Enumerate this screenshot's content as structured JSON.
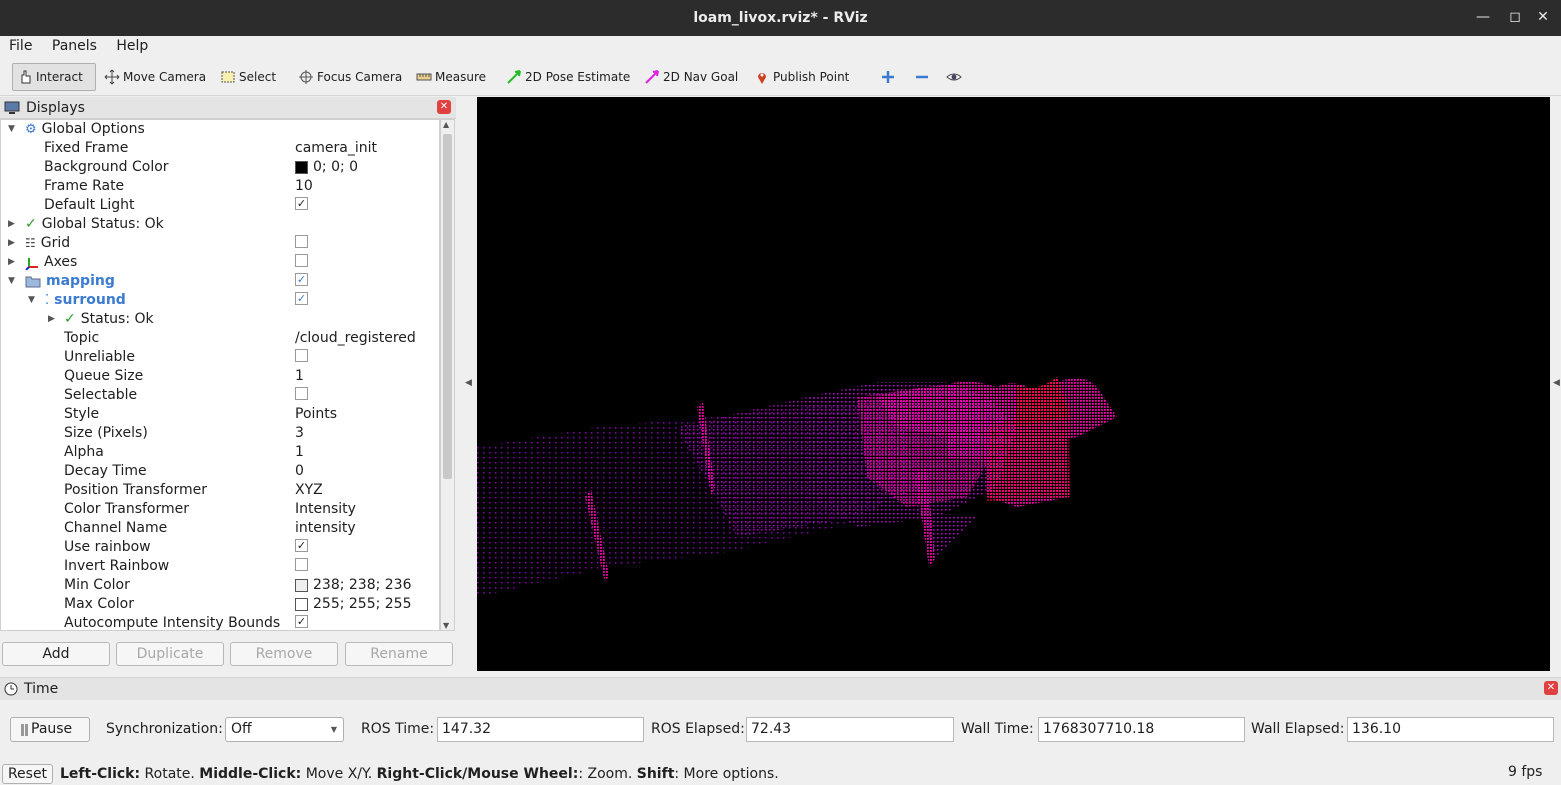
{
  "window": {
    "title": "loam_livox.rviz* - RViz"
  },
  "menu": {
    "file": "File",
    "panels": "Panels",
    "help": "Help"
  },
  "toolbar": {
    "interact": "Interact",
    "move_camera": "Move Camera",
    "select": "Select",
    "focus_camera": "Focus Camera",
    "measure": "Measure",
    "pose_estimate": "2D Pose Estimate",
    "nav_goal": "2D Nav Goal",
    "publish_point": "Publish Point"
  },
  "displays": {
    "title": "Displays",
    "global_options": "Global Options",
    "fixed_frame": {
      "label": "Fixed Frame",
      "value": "camera_init"
    },
    "background_color": {
      "label": "Background Color",
      "value": "0; 0; 0",
      "swatch": "#000000"
    },
    "frame_rate": {
      "label": "Frame Rate",
      "value": "10"
    },
    "default_light": {
      "label": "Default Light",
      "checked": true
    },
    "global_status": "Global Status: Ok",
    "grid": "Grid",
    "axes": "Axes",
    "mapping": "mapping",
    "surround": "surround",
    "status": "Status: Ok",
    "topic": {
      "label": "Topic",
      "value": "/cloud_registered"
    },
    "unreliable": {
      "label": "Unreliable",
      "checked": false
    },
    "queue_size": {
      "label": "Queue Size",
      "value": "1"
    },
    "selectable": {
      "label": "Selectable",
      "checked": false
    },
    "style": {
      "label": "Style",
      "value": "Points"
    },
    "size": {
      "label": "Size (Pixels)",
      "value": "3"
    },
    "alpha": {
      "label": "Alpha",
      "value": "1"
    },
    "decay_time": {
      "label": "Decay Time",
      "value": "0"
    },
    "position_transformer": {
      "label": "Position Transformer",
      "value": "XYZ"
    },
    "color_transformer": {
      "label": "Color Transformer",
      "value": "Intensity"
    },
    "channel_name": {
      "label": "Channel Name",
      "value": "intensity"
    },
    "use_rainbow": {
      "label": "Use rainbow",
      "checked": true
    },
    "invert_rainbow": {
      "label": "Invert Rainbow",
      "checked": false
    },
    "min_color": {
      "label": "Min Color",
      "value": "238; 238; 236",
      "swatch": "#eeeeec"
    },
    "max_color": {
      "label": "Max Color",
      "value": "255; 255; 255",
      "swatch": "#ffffff"
    },
    "autocompute": {
      "label": "Autocompute Intensity Bounds",
      "checked": true
    }
  },
  "panel_buttons": {
    "add": "Add",
    "duplicate": "Duplicate",
    "remove": "Remove",
    "rename": "Rename"
  },
  "time": {
    "title": "Time",
    "pause": "Pause",
    "sync_label": "Synchronization:",
    "sync_value": "Off",
    "ros_time_label": "ROS Time:",
    "ros_time": "147.32",
    "ros_elapsed_label": "ROS Elapsed:",
    "ros_elapsed": "72.43",
    "wall_time_label": "Wall Time:",
    "wall_time": "1768307710.18",
    "wall_elapsed_label": "Wall Elapsed:",
    "wall_elapsed": "136.10"
  },
  "status": {
    "reset": "Reset",
    "left_click": "Left-Click:",
    "left_click_desc": " Rotate. ",
    "middle_click": "Middle-Click:",
    "middle_click_desc": " Move X/Y. ",
    "right_click": "Right-Click/Mouse Wheel:",
    "right_click_desc": ": Zoom. ",
    "shift": "Shift",
    "shift_desc": ": More options.",
    "fps": "9 fps"
  },
  "colors": {
    "accent": "#3b7bd0",
    "cloud_magenta": "#ff00c8",
    "cloud_red": "#ff1040",
    "viewport_bg": "#000000"
  }
}
